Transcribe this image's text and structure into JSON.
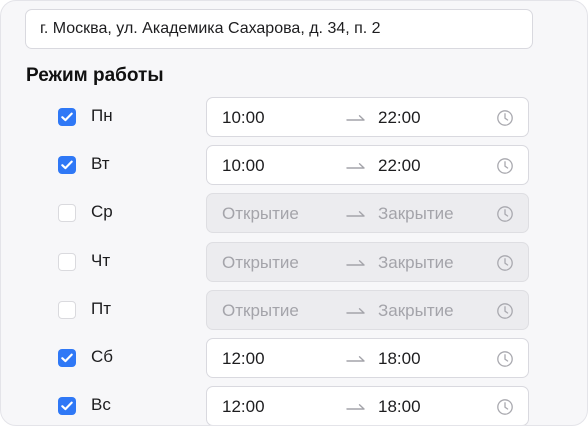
{
  "address": {
    "value": "г. Москва, ул. Академика Сахарова, д. 34, п. 2"
  },
  "schedule": {
    "title": "Режим работы",
    "placeholders": {
      "open": "Открытие",
      "close": "Закрытие"
    },
    "days": [
      {
        "label": "Пн",
        "enabled": true,
        "open": "10:00",
        "close": "22:00"
      },
      {
        "label": "Вт",
        "enabled": true,
        "open": "10:00",
        "close": "22:00"
      },
      {
        "label": "Ср",
        "enabled": false,
        "open": "",
        "close": ""
      },
      {
        "label": "Чт",
        "enabled": false,
        "open": "",
        "close": ""
      },
      {
        "label": "Пт",
        "enabled": false,
        "open": "",
        "close": ""
      },
      {
        "label": "Сб",
        "enabled": true,
        "open": "12:00",
        "close": "18:00"
      },
      {
        "label": "Вс",
        "enabled": true,
        "open": "12:00",
        "close": "18:00"
      }
    ]
  },
  "icons": {
    "check": "check-icon",
    "arrow": "arrow-right-icon",
    "clock": "clock-icon"
  },
  "colors": {
    "accent": "#2f78f6",
    "disabled_field": "#ececef",
    "placeholder_text": "#a4a4aa"
  }
}
